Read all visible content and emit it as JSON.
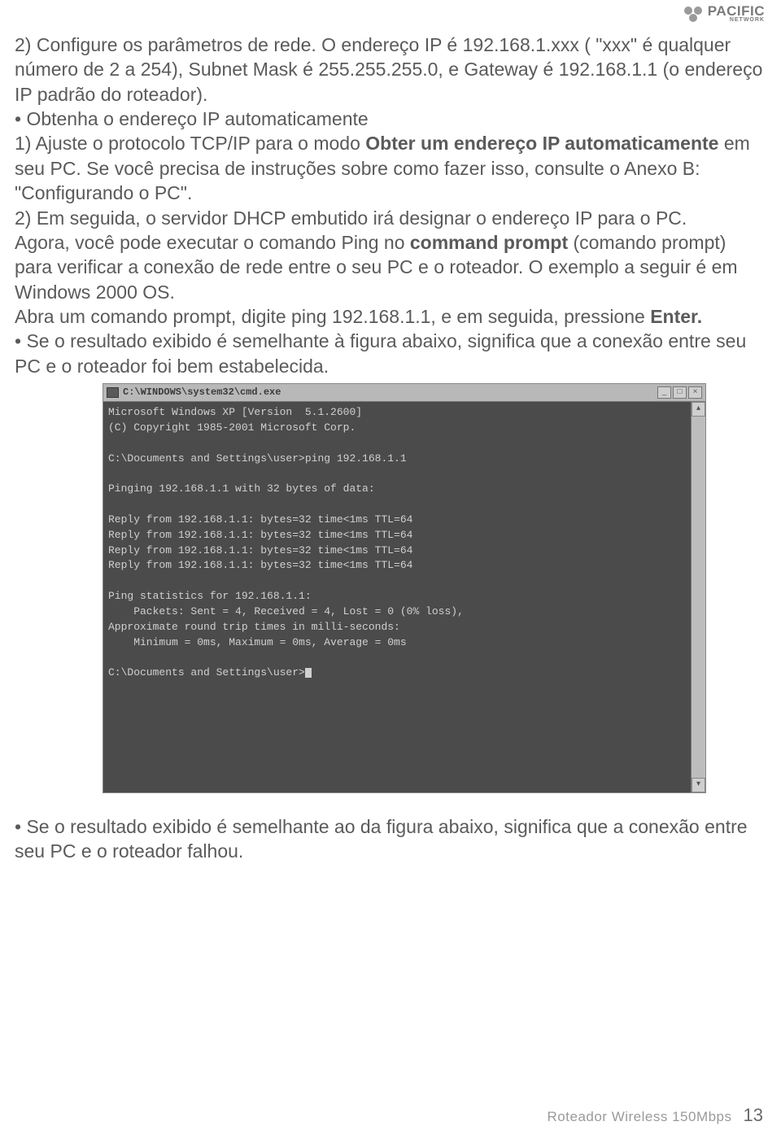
{
  "logo": {
    "brand": "PACIFIC",
    "subtitle": "NETWORK"
  },
  "body": {
    "p1a": "2)  Configure os parâmetros de rede. O endereço IP é 192.168.1.xxx ( \"xxx\" é qualquer número de 2 a 254), Subnet Mask é 255.255.255.0, e Gateway é 192.168.1.1 (o endereço IP padrão do roteador).",
    "p2a": "•  Obtenha o endereço IP automaticamente",
    "p2b_a": "1)  Ajuste o protocolo TCP/IP para o modo ",
    "p2b_bold": "Obter um endereço IP automaticamente",
    "p2b_c": " em seu PC. Se você precisa de instruções sobre como fazer isso, consulte o Anexo B: \"Configurando o PC\".",
    "p2c": "2)  Em seguida, o servidor DHCP embutido irá designar o endereço IP para o PC.",
    "p3a": "Agora, você pode executar o comando Ping no ",
    "p3_bold": "command prompt",
    "p3b": " (comando prompt) para verificar a conexão de rede entre o seu PC e o roteador. O exemplo a seguir é em Windows 2000 OS.",
    "p4a": "Abra um comando prompt, digite ping 192.168.1.1, e em seguida, pressione ",
    "p4_bold": "Enter.",
    "p5": "•  Se o resultado exibido é semelhante à figura abaixo, significa que a conexão entre seu PC e o roteador foi bem estabelecida.",
    "p6": "•  Se o resultado exibido é semelhante ao da figura abaixo, significa que a conexão entre seu PC e o roteador falhou."
  },
  "terminal": {
    "title": "C:\\WINDOWS\\system32\\cmd.exe",
    "lines": [
      "Microsoft Windows XP [Version  5.1.2600]",
      "(C) Copyright 1985-2001 Microsoft Corp.",
      "",
      "C:\\Documents and Settings\\user>ping 192.168.1.1",
      "",
      "Pinging 192.168.1.1 with 32 bytes of data:",
      "",
      "Reply from 192.168.1.1: bytes=32 time<1ms TTL=64",
      "Reply from 192.168.1.1: bytes=32 time<1ms TTL=64",
      "Reply from 192.168.1.1: bytes=32 time<1ms TTL=64",
      "Reply from 192.168.1.1: bytes=32 time<1ms TTL=64",
      "",
      "Ping statistics for 192.168.1.1:",
      "    Packets: Sent = 4, Received = 4, Lost = 0 (0% loss),",
      "Approximate round trip times in milli-seconds:",
      "    Minimum = 0ms, Maximum = 0ms, Average = 0ms",
      "",
      "C:\\Documents and Settings\\user>"
    ]
  },
  "footer": {
    "title": "Roteador Wireless 150Mbps",
    "page": "13"
  }
}
